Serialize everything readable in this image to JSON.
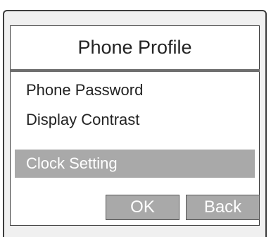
{
  "dialog": {
    "title": "Phone Profile"
  },
  "menu": {
    "items": [
      {
        "label": "Phone Password"
      },
      {
        "label": "Display Contrast"
      },
      {
        "label": "Clock Setting",
        "selected": true
      }
    ]
  },
  "buttons": {
    "ok_label": "OK",
    "back_label": "Back"
  },
  "colors": {
    "selection": "#a9a9a9",
    "frame": "#3c3c3c",
    "background": "#f0f0f0"
  }
}
